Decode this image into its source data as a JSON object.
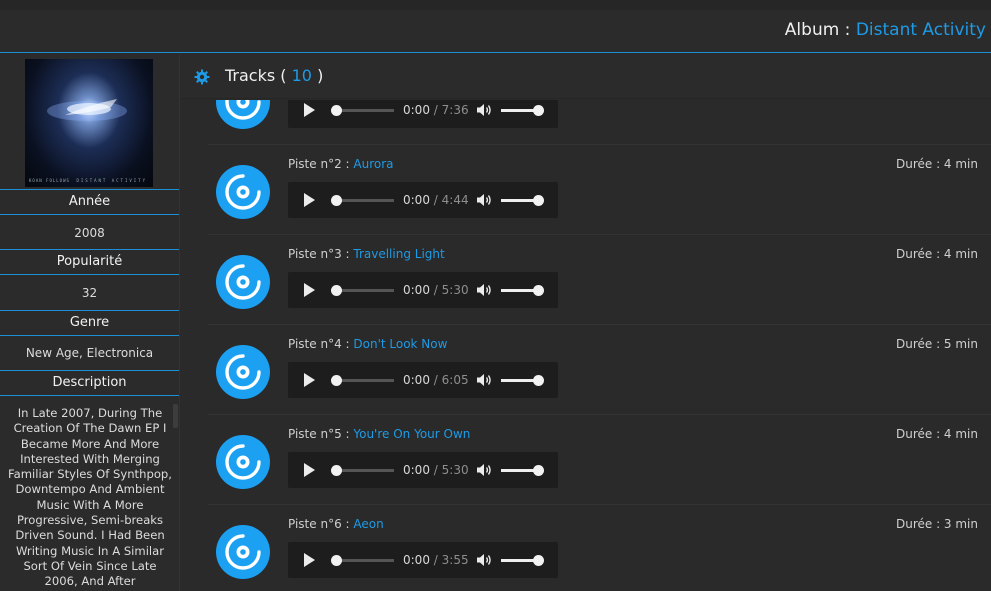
{
  "header": {
    "album_prefix": "Album : ",
    "album_name": "Distant Activity"
  },
  "cover": {
    "caption_left": "KOAN FOLLOWS",
    "caption_right": "DISTANT ACTIVITY"
  },
  "sidebar": {
    "year_label": "Année",
    "year_value": "2008",
    "popularity_label": "Popularité",
    "popularity_value": "32",
    "genre_label": "Genre",
    "genre_value": "New Age, Electronica",
    "description_label": "Description",
    "description_text": "In Late 2007, During The Creation Of The Dawn EP I Became More And More Interested With Merging Familiar Styles Of Synthpop, Downtempo And Ambient Music With A More Progressive, Semi-breaks Driven Sound. I Had Been Writing Music In A Similar Sort Of Vein Since Late 2006, And After"
  },
  "tracks_header": {
    "title": "Tracks",
    "open_paren": "( ",
    "count": "10",
    "close_paren": " )"
  },
  "tracks": [
    {
      "label": "",
      "name": "",
      "duration": "",
      "current": "0:00",
      "total": "/ 7:36"
    },
    {
      "label": "Piste n°2 : ",
      "name": "Aurora",
      "duration": "Durée : 4 min",
      "current": "0:00",
      "total": "/ 4:44"
    },
    {
      "label": "Piste n°3 : ",
      "name": "Travelling Light",
      "duration": "Durée : 4 min",
      "current": "0:00",
      "total": "/ 5:30"
    },
    {
      "label": "Piste n°4 : ",
      "name": "Don't Look Now",
      "duration": "Durée : 5 min",
      "current": "0:00",
      "total": "/ 6:05"
    },
    {
      "label": "Piste n°5 : ",
      "name": "You're On Your Own",
      "duration": "Durée : 4 min",
      "current": "0:00",
      "total": "/ 5:30"
    },
    {
      "label": "Piste n°6 : ",
      "name": "Aeon",
      "duration": "Durée : 3 min",
      "current": "0:00",
      "total": "/ 3:55"
    }
  ],
  "colors": {
    "accent": "#1e9be6",
    "background": "#2a2a2a",
    "player_bg": "#1d1d1d"
  },
  "icons": {
    "tracks_header": "gear-icon",
    "track": "disc-icon",
    "play": "play-icon",
    "volume": "volume-icon"
  }
}
